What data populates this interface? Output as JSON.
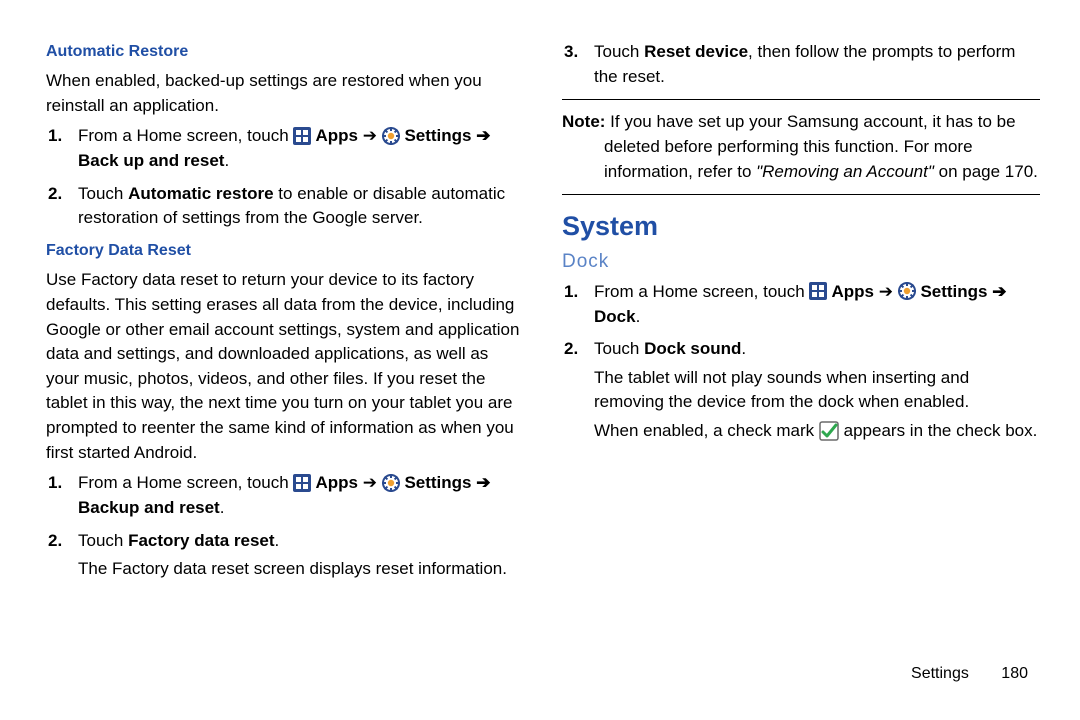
{
  "left": {
    "autoRestore": {
      "heading": "Automatic Restore",
      "intro": "When enabled, backed-up settings are restored when you reinstall an application.",
      "step1_pre": "From a Home screen, touch ",
      "apps": " Apps",
      "arrow": " ➔ ",
      "settings": " Settings ",
      "step1_post": "➔ Back up and reset",
      "step1_end": ".",
      "step2a": "Touch ",
      "step2b": "Automatic restore",
      "step2c": " to enable or disable automatic restoration of settings from the Google server."
    },
    "factory": {
      "heading": "Factory Data Reset",
      "intro": "Use Factory data reset to return your device to its factory defaults. This setting erases all data from the device, including Google or other email account settings, system and application data and settings, and downloaded applications, as well as your music, photos, videos, and other files. If you reset the tablet in this way, the next time you turn on your tablet you are prompted to reenter the same kind of information as when you first started Android.",
      "step1_pre": "From a Home screen, touch ",
      "apps": " Apps",
      "arrow": " ➔ ",
      "settings": " Settings ",
      "step1_post": "➔ Backup and reset",
      "step1_end": ".",
      "step2a": "Touch ",
      "step2b": "Factory data reset",
      "step2c": ".",
      "step2d": "The Factory data reset screen displays reset information."
    }
  },
  "right": {
    "step3a": "Touch ",
    "step3b": "Reset device",
    "step3c": ", then follow the prompts to perform the reset.",
    "noteLabel": "Note:",
    "noteBody1": " If you have set up your Samsung account, it has to be deleted before performing this function. For more information, refer to ",
    "noteBody2": "\"Removing an Account\"",
    "noteBody3": "  on page 170.",
    "system": {
      "heading": "System",
      "dockHeading": "Dock",
      "step1_pre": "From a Home screen, touch ",
      "apps": " Apps",
      "arrow": " ➔ ",
      "settings": " Settings ",
      "step1_post": "➔ Dock",
      "step1_end": ".",
      "step2a": "Touch ",
      "step2b": "Dock sound",
      "step2c": ".",
      "step2d": "The tablet will not play sounds when inserting and removing the device from the dock when enabled.",
      "step2e1": "When enabled, a check mark ",
      "step2e2": " appears in the check box."
    }
  },
  "footer": {
    "section": "Settings",
    "page": "180"
  },
  "nums": {
    "n1": "1.",
    "n2": "2.",
    "n3": "3."
  }
}
